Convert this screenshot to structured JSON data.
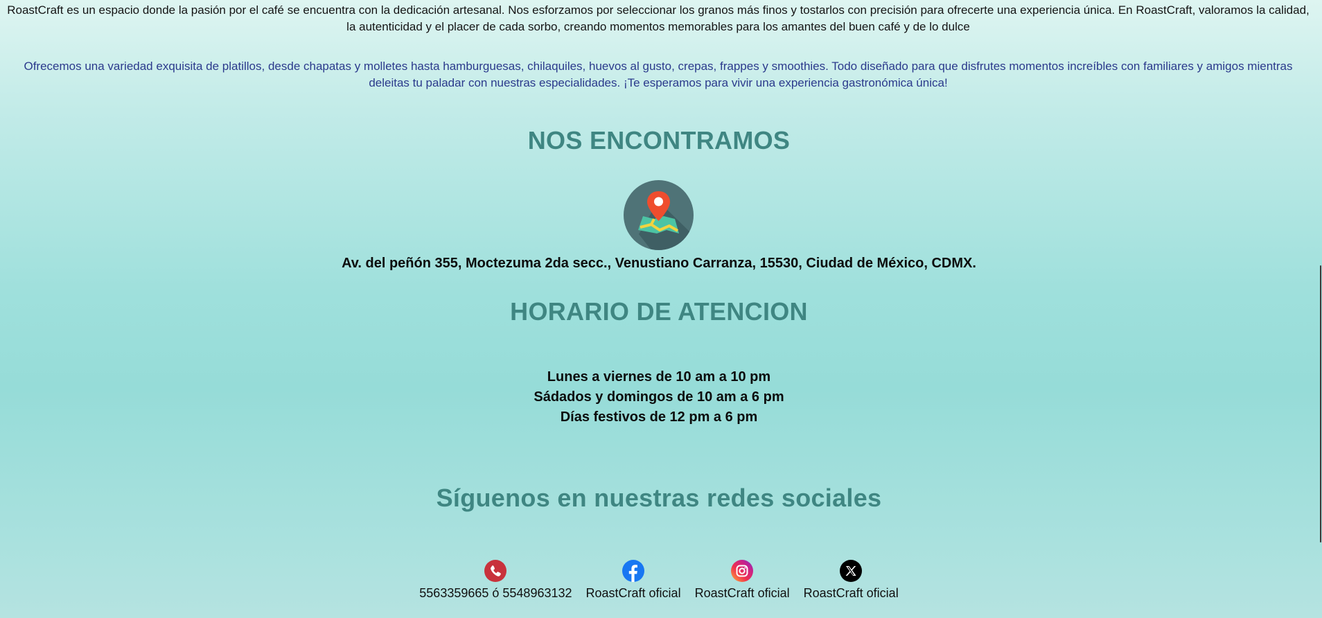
{
  "about": {
    "intro": "RoastCraft es un espacio donde la pasión por el café se encuentra con la dedicación artesanal. Nos esforzamos por seleccionar los granos más finos y tostarlos con precisión para ofrecerte una experiencia única. En RoastCraft, valoramos la calidad, la autenticidad y el placer de cada sorbo, creando momentos memorables para los amantes del buen café y de lo dulce",
    "menu": "Ofrecemos una variedad exquisita de platillos, desde chapatas y molletes hasta hamburguesas, chilaquiles, huevos al gusto, crepas, frappes y smoothies. Todo diseñado para que disfrutes momentos increíbles con familiares y amigos mientras deleitas tu paladar con nuestras especialidades. ¡Te esperamos para vivir una experiencia gastronómica única!"
  },
  "location": {
    "title": "NOS ENCONTRAMOS",
    "icon": "map-location-icon",
    "address": "Av. del peñón 355, Moctezuma 2da secc., Venustiano Carranza, 15530, Ciudad de México, CDMX."
  },
  "hours": {
    "title": "HORARIO DE ATENCION",
    "lines": [
      "Lunes a viernes de 10 am a 10 pm",
      "Sádados y domingos de 10 am a 6 pm",
      "Días festivos de 12 pm a 6 pm"
    ]
  },
  "social": {
    "title": "Síguenos en nuestras redes sociales",
    "links": [
      {
        "icon": "phone-icon",
        "label": "5563359665 ó 5548963132"
      },
      {
        "icon": "facebook-icon",
        "label": "RoastCraft oficial"
      },
      {
        "icon": "instagram-icon",
        "label": "RoastCraft oficial"
      },
      {
        "icon": "x-icon",
        "label": "RoastCraft oficial"
      }
    ]
  },
  "colors": {
    "heading": "#3f8682",
    "menu_text": "#2b3a8c",
    "phone": "#c8323c",
    "facebook": "#1877f2",
    "x": "#000000"
  }
}
